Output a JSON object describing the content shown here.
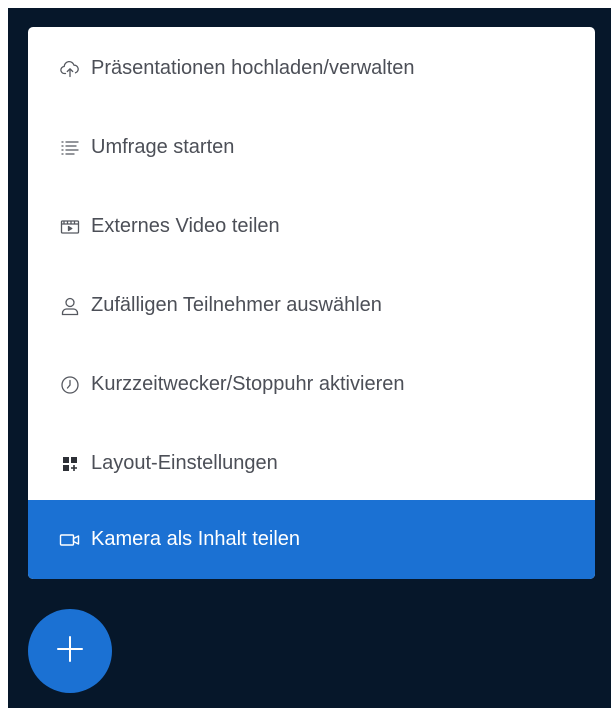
{
  "actions_menu": {
    "items": [
      {
        "label": "Präsentationen hochladen/verwalten",
        "icon": "cloud-upload-icon",
        "active": false
      },
      {
        "label": "Umfrage starten",
        "icon": "poll-list-icon",
        "active": false
      },
      {
        "label": "Externes Video teilen",
        "icon": "external-video-icon",
        "active": false
      },
      {
        "label": "Zufälligen Teilnehmer auswählen",
        "icon": "user-icon",
        "active": false
      },
      {
        "label": "Kurzzeitwecker/Stoppuhr aktivieren",
        "icon": "clock-icon",
        "active": false
      },
      {
        "label": "Layout-Einstellungen",
        "icon": "layout-grid-icon",
        "active": false
      },
      {
        "label": "Kamera als Inhalt teilen",
        "icon": "video-camera-icon",
        "active": true
      }
    ]
  },
  "actions_button": {
    "icon": "plus-icon"
  },
  "colors": {
    "background_dark": "#06172a",
    "accent": "#1b71d3",
    "menu_text": "#4c4f57",
    "menu_background": "#ffffff"
  }
}
